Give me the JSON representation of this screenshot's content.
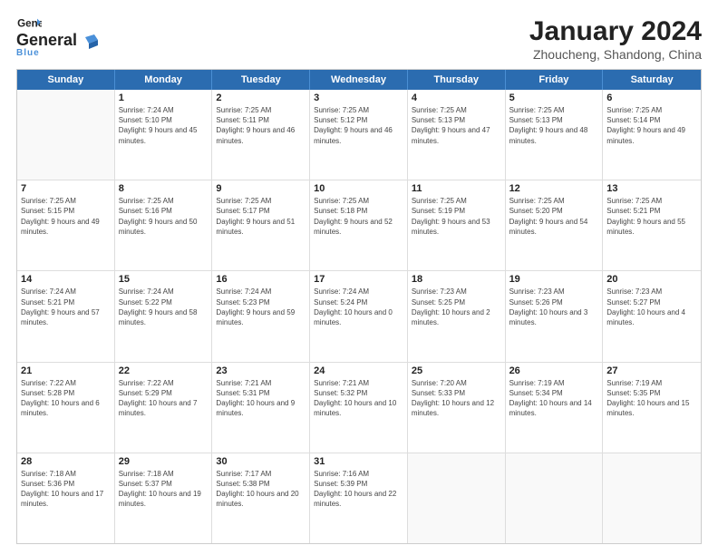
{
  "logo": {
    "name": "General",
    "accent": "Blue",
    "icon_color": "#4a90d9"
  },
  "title": "January 2024",
  "subtitle": "Zhoucheng, Shandong, China",
  "header_days": [
    "Sunday",
    "Monday",
    "Tuesday",
    "Wednesday",
    "Thursday",
    "Friday",
    "Saturday"
  ],
  "weeks": [
    [
      {
        "day": "",
        "empty": true
      },
      {
        "day": "1",
        "sunrise": "7:24 AM",
        "sunset": "5:10 PM",
        "daylight": "9 hours and 45 minutes."
      },
      {
        "day": "2",
        "sunrise": "7:25 AM",
        "sunset": "5:11 PM",
        "daylight": "9 hours and 46 minutes."
      },
      {
        "day": "3",
        "sunrise": "7:25 AM",
        "sunset": "5:12 PM",
        "daylight": "9 hours and 46 minutes."
      },
      {
        "day": "4",
        "sunrise": "7:25 AM",
        "sunset": "5:13 PM",
        "daylight": "9 hours and 47 minutes."
      },
      {
        "day": "5",
        "sunrise": "7:25 AM",
        "sunset": "5:13 PM",
        "daylight": "9 hours and 48 minutes."
      },
      {
        "day": "6",
        "sunrise": "7:25 AM",
        "sunset": "5:14 PM",
        "daylight": "9 hours and 49 minutes."
      }
    ],
    [
      {
        "day": "7",
        "sunrise": "7:25 AM",
        "sunset": "5:15 PM",
        "daylight": "9 hours and 49 minutes."
      },
      {
        "day": "8",
        "sunrise": "7:25 AM",
        "sunset": "5:16 PM",
        "daylight": "9 hours and 50 minutes."
      },
      {
        "day": "9",
        "sunrise": "7:25 AM",
        "sunset": "5:17 PM",
        "daylight": "9 hours and 51 minutes."
      },
      {
        "day": "10",
        "sunrise": "7:25 AM",
        "sunset": "5:18 PM",
        "daylight": "9 hours and 52 minutes."
      },
      {
        "day": "11",
        "sunrise": "7:25 AM",
        "sunset": "5:19 PM",
        "daylight": "9 hours and 53 minutes."
      },
      {
        "day": "12",
        "sunrise": "7:25 AM",
        "sunset": "5:20 PM",
        "daylight": "9 hours and 54 minutes."
      },
      {
        "day": "13",
        "sunrise": "7:25 AM",
        "sunset": "5:21 PM",
        "daylight": "9 hours and 55 minutes."
      }
    ],
    [
      {
        "day": "14",
        "sunrise": "7:24 AM",
        "sunset": "5:21 PM",
        "daylight": "9 hours and 57 minutes."
      },
      {
        "day": "15",
        "sunrise": "7:24 AM",
        "sunset": "5:22 PM",
        "daylight": "9 hours and 58 minutes."
      },
      {
        "day": "16",
        "sunrise": "7:24 AM",
        "sunset": "5:23 PM",
        "daylight": "9 hours and 59 minutes."
      },
      {
        "day": "17",
        "sunrise": "7:24 AM",
        "sunset": "5:24 PM",
        "daylight": "10 hours and 0 minutes."
      },
      {
        "day": "18",
        "sunrise": "7:23 AM",
        "sunset": "5:25 PM",
        "daylight": "10 hours and 2 minutes."
      },
      {
        "day": "19",
        "sunrise": "7:23 AM",
        "sunset": "5:26 PM",
        "daylight": "10 hours and 3 minutes."
      },
      {
        "day": "20",
        "sunrise": "7:23 AM",
        "sunset": "5:27 PM",
        "daylight": "10 hours and 4 minutes."
      }
    ],
    [
      {
        "day": "21",
        "sunrise": "7:22 AM",
        "sunset": "5:28 PM",
        "daylight": "10 hours and 6 minutes."
      },
      {
        "day": "22",
        "sunrise": "7:22 AM",
        "sunset": "5:29 PM",
        "daylight": "10 hours and 7 minutes."
      },
      {
        "day": "23",
        "sunrise": "7:21 AM",
        "sunset": "5:31 PM",
        "daylight": "10 hours and 9 minutes."
      },
      {
        "day": "24",
        "sunrise": "7:21 AM",
        "sunset": "5:32 PM",
        "daylight": "10 hours and 10 minutes."
      },
      {
        "day": "25",
        "sunrise": "7:20 AM",
        "sunset": "5:33 PM",
        "daylight": "10 hours and 12 minutes."
      },
      {
        "day": "26",
        "sunrise": "7:19 AM",
        "sunset": "5:34 PM",
        "daylight": "10 hours and 14 minutes."
      },
      {
        "day": "27",
        "sunrise": "7:19 AM",
        "sunset": "5:35 PM",
        "daylight": "10 hours and 15 minutes."
      }
    ],
    [
      {
        "day": "28",
        "sunrise": "7:18 AM",
        "sunset": "5:36 PM",
        "daylight": "10 hours and 17 minutes."
      },
      {
        "day": "29",
        "sunrise": "7:18 AM",
        "sunset": "5:37 PM",
        "daylight": "10 hours and 19 minutes."
      },
      {
        "day": "30",
        "sunrise": "7:17 AM",
        "sunset": "5:38 PM",
        "daylight": "10 hours and 20 minutes."
      },
      {
        "day": "31",
        "sunrise": "7:16 AM",
        "sunset": "5:39 PM",
        "daylight": "10 hours and 22 minutes."
      },
      {
        "day": "",
        "empty": true
      },
      {
        "day": "",
        "empty": true
      },
      {
        "day": "",
        "empty": true
      }
    ]
  ]
}
